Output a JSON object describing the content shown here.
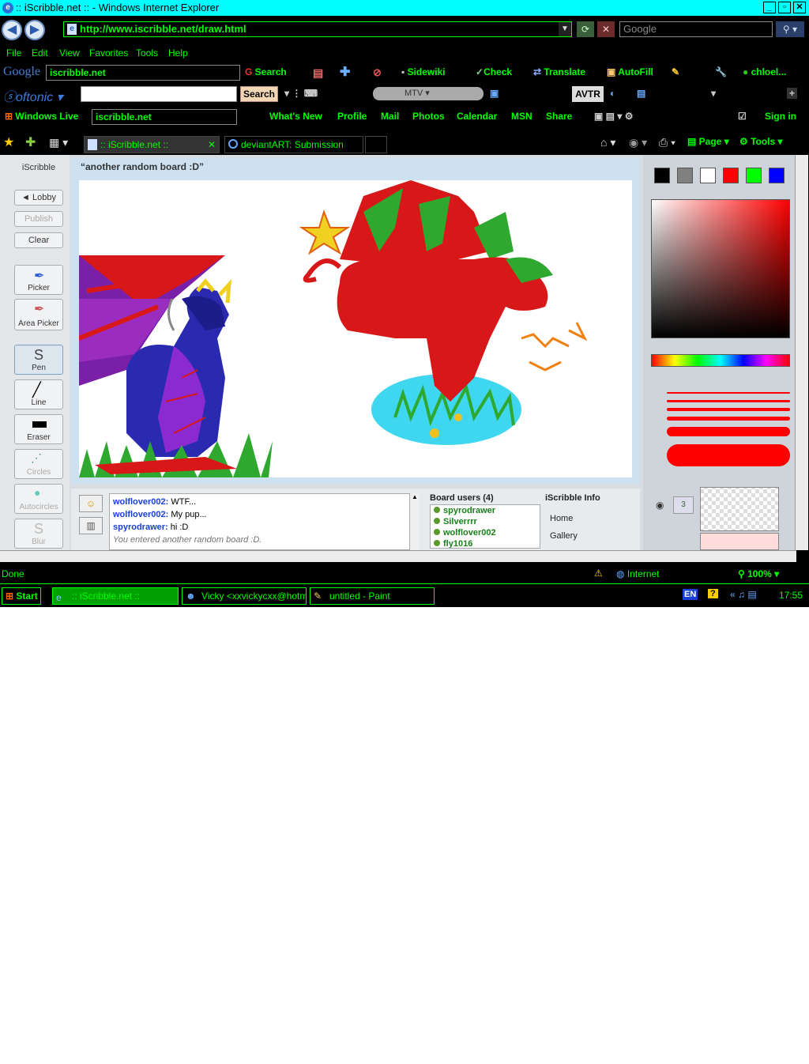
{
  "window": {
    "title": ":: iScribble.net :: - Windows Internet Explorer",
    "url": "http://www.iscribble.net/draw.html",
    "search_placeholder": "Google"
  },
  "menu": [
    "File",
    "Edit",
    "View",
    "Favorites",
    "Tools",
    "Help"
  ],
  "google_bar": {
    "query": "iscribble.net",
    "search_label": "Search",
    "items": [
      "Sidewiki",
      "Check",
      "Translate",
      "AutoFill",
      "chloel..."
    ]
  },
  "softonic_bar": {
    "search_label": "Search",
    "station": "MTV",
    "avtr": "AVTR"
  },
  "live_bar": {
    "brand": "Windows Live",
    "query": "iscribble.net",
    "links": [
      "What's New",
      "Profile",
      "Mail",
      "Photos",
      "Calendar",
      "MSN",
      "Share"
    ],
    "sign_in": "Sign in"
  },
  "tabs": [
    {
      "label": ":: iScribble.net ::"
    },
    {
      "label": "deviantART: Submission"
    }
  ],
  "cmdbar": {
    "page": "Page",
    "tools": "Tools"
  },
  "app": {
    "brand": "iScribble",
    "board_title": "“another random board :D”",
    "buttons": {
      "lobby": "◄ Lobby",
      "publish": "Publish",
      "clear": "Clear"
    },
    "tools": [
      "Picker",
      "Area Picker",
      "Pen",
      "Line",
      "Eraser",
      "Circles",
      "Autocircles",
      "Blur"
    ],
    "palette": [
      "#000000",
      "#808080",
      "#ffffff",
      "#ff0000",
      "#00ff00",
      "#0000ff"
    ],
    "brush_color": "#ff0000"
  },
  "chat": {
    "messages": [
      {
        "user": "wolflover002:",
        "text": " WTF..."
      },
      {
        "user": "wolflover002:",
        "text": " My pup..."
      },
      {
        "user": "spyrodrawer:",
        "text": " hi :D"
      }
    ],
    "system": "You entered another random board :D."
  },
  "board_users": {
    "title": "Board users (4)",
    "users": [
      "spyrodrawer",
      "Silverrrr",
      "wolflover002",
      "fly1016"
    ]
  },
  "info": {
    "title": "iScribble Info",
    "links": [
      "Home",
      "Gallery"
    ]
  },
  "layers": {
    "badge": "3"
  },
  "status": {
    "left": "Done",
    "zone": "Internet",
    "zoom": "100%"
  },
  "taskbar": {
    "start": "Start",
    "tasks": [
      ":: iScribble.net ::",
      "Vicky <xxvickycxx@hotm...",
      "untitled - Paint"
    ],
    "lang": "EN",
    "time": "17:55"
  }
}
